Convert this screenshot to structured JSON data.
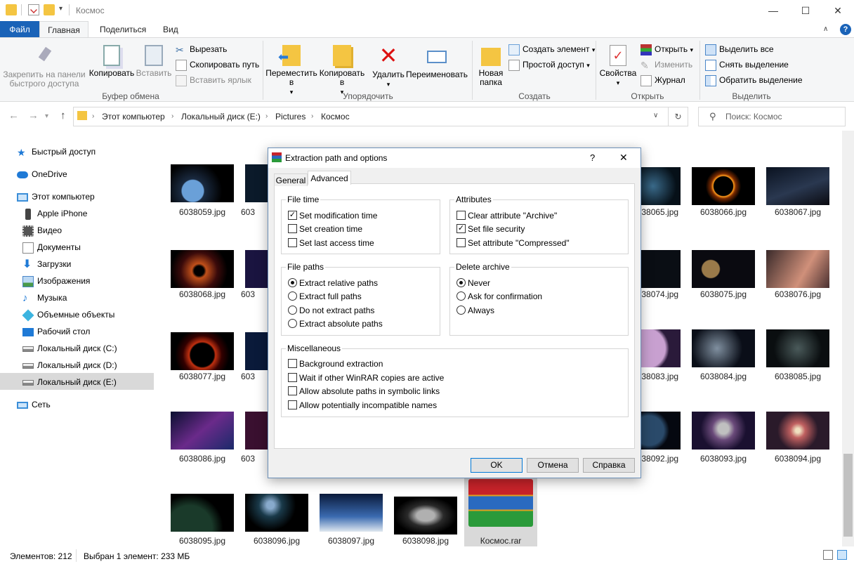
{
  "window": {
    "title": "Космос",
    "minimize": "—",
    "maximize": "☐",
    "close": "✕"
  },
  "ribbon_tabs": [
    "Файл",
    "Главная",
    "Поделиться",
    "Вид"
  ],
  "ribbon": {
    "clipboard": {
      "label": "Буфер обмена",
      "pin": "Закрепить на панели быстрого доступа",
      "copy": "Копировать",
      "paste": "Вставить",
      "cut": "Вырезать",
      "copy_path": "Скопировать путь",
      "paste_shortcut": "Вставить ярлык"
    },
    "organize": {
      "label": "Упорядочить",
      "move_to": "Переместить в",
      "copy_to": "Копировать в",
      "delete": "Удалить",
      "rename": "Переименовать"
    },
    "new": {
      "label": "Создать",
      "new_folder": "Новая папка",
      "new_item": "Создать элемент",
      "easy_access": "Простой доступ"
    },
    "open": {
      "label": "Открыть",
      "properties": "Свойства",
      "open": "Открыть",
      "edit": "Изменить",
      "history": "Журнал"
    },
    "select": {
      "label": "Выделить",
      "select_all": "Выделить все",
      "select_none": "Снять выделение",
      "invert": "Обратить выделение"
    }
  },
  "address": {
    "crumbs": [
      "Этот компьютер",
      "Локальный диск (E:)",
      "Pictures",
      "Космос"
    ],
    "search_placeholder": "Поиск: Космос"
  },
  "nav": {
    "quick_access": "Быстрый доступ",
    "onedrive": "OneDrive",
    "this_pc": "Этот компьютер",
    "items": [
      "Apple iPhone",
      "Видео",
      "Документы",
      "Загрузки",
      "Изображения",
      "Музыка",
      "Объемные объекты",
      "Рабочий стол",
      "Локальный диск (C:)",
      "Локальный диск (D:)",
      "Локальный диск (E:)"
    ],
    "network": "Сеть"
  },
  "files": {
    "row1": [
      "6038059.jpg",
      "603",
      "6038065.jpg",
      "6038066.jpg",
      "6038067.jpg"
    ],
    "row2": [
      "6038068.jpg",
      "603",
      "6038074.jpg",
      "6038075.jpg",
      "6038076.jpg"
    ],
    "row3": [
      "6038077.jpg",
      "603",
      "6038083.jpg",
      "6038084.jpg",
      "6038085.jpg"
    ],
    "row4": [
      "6038086.jpg",
      "603",
      "6038092.jpg",
      "6038093.jpg",
      "6038094.jpg"
    ],
    "row5": [
      "6038095.jpg",
      "6038096.jpg",
      "6038097.jpg",
      "6038098.jpg",
      "Космос.rar"
    ]
  },
  "status": {
    "count": "Элементов: 212",
    "selected": "Выбран 1 элемент: 233 МБ"
  },
  "dialog": {
    "title": "Extraction path and options",
    "help": "?",
    "close": "✕",
    "tabs": [
      "General",
      "Advanced"
    ],
    "file_time": {
      "label": "File time",
      "options": [
        {
          "text": "Set modification time",
          "checked": true
        },
        {
          "text": "Set creation time",
          "checked": false
        },
        {
          "text": "Set last access time",
          "checked": false
        }
      ]
    },
    "attributes": {
      "label": "Attributes",
      "options": [
        {
          "text": "Clear attribute \"Archive\"",
          "checked": false
        },
        {
          "text": "Set file security",
          "checked": true
        },
        {
          "text": "Set attribute \"Compressed\"",
          "checked": false
        }
      ]
    },
    "file_paths": {
      "label": "File paths",
      "options": [
        {
          "text": "Extract relative paths",
          "selected": true
        },
        {
          "text": "Extract full paths",
          "selected": false
        },
        {
          "text": "Do not extract paths",
          "selected": false
        },
        {
          "text": "Extract absolute paths",
          "selected": false
        }
      ]
    },
    "delete_archive": {
      "label": "Delete archive",
      "options": [
        {
          "text": "Never",
          "selected": true
        },
        {
          "text": "Ask for confirmation",
          "selected": false
        },
        {
          "text": "Always",
          "selected": false
        }
      ]
    },
    "misc": {
      "label": "Miscellaneous",
      "options": [
        {
          "text": "Background extraction",
          "checked": false
        },
        {
          "text": "Wait if other WinRAR copies are active",
          "checked": false
        },
        {
          "text": "Allow absolute paths in symbolic links",
          "checked": false
        },
        {
          "text": "Allow potentially incompatible names",
          "checked": false
        }
      ]
    },
    "ok": "OK",
    "cancel": "Отмена",
    "help_button": "Справка"
  }
}
